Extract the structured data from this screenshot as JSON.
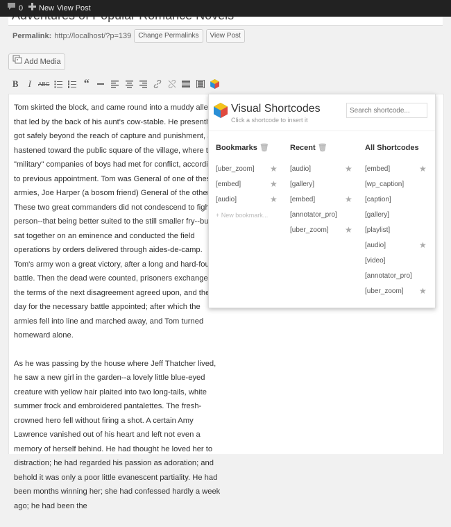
{
  "admin_bar": {
    "comments_count": "0",
    "new_label": "New",
    "view_post_label": "View Post"
  },
  "post": {
    "title_fragment": "Adventures of Popular Romance Novels"
  },
  "permalink": {
    "label": "Permalink:",
    "url": "http://localhost/?p=139",
    "change_button": "Change Permalinks",
    "view_button": "View Post"
  },
  "add_media_label": "Add Media",
  "editor": {
    "paragraphs": [
      "Tom skirted the block, and came round into a muddy alley that led by the back of his aunt's cow-stable. He presently got safely beyond the reach of capture and punishment, and hastened toward the public square of the village, where two \"military\" companies of boys had met for conflict, according to previous appointment. Tom was General of one of these armies, Joe Harper (a bosom friend) General of the other. These two great commanders did not condescend to fight in person--that being better suited to the still smaller fry--but sat together on an eminence and conducted the field operations by orders delivered through aides-de-camp. Tom's army won a great victory, after a long and hard-fought battle. Then the dead were counted, prisoners exchanged, the terms of the next disagreement agreed upon, and the day for the necessary battle appointed; after which the armies fell into line and marched away, and Tom turned homeward alone.",
      "As he was passing by the house where Jeff Thatcher lived, he saw a new girl in the garden--a lovely little blue-eyed creature with yellow hair plaited into two long-tails, white summer frock and embroidered pantalettes. The fresh-crowned hero fell without firing a shot. A certain Amy Lawrence vanished out of his heart and left not even a memory of herself behind. He had thought he loved her to distraction; he had regarded his passion as adoration; and behold it was only a poor little evanescent partiality. He had been months winning her; she had confessed hardly a week ago; he had been the"
    ]
  },
  "popup": {
    "title": "Visual Shortcodes",
    "subtitle": "Click a shortcode to insert it",
    "search_placeholder": "Search shortcode...",
    "bookmarks": {
      "title": "Bookmarks",
      "items": [
        "[uber_zoom]",
        "[embed]",
        "[audio]"
      ],
      "new_label": "+ New bookmark..."
    },
    "recent": {
      "title": "Recent",
      "items": [
        "[audio]",
        "[gallery]",
        "[embed]",
        "[annotator_pro]",
        "[uber_zoom]"
      ]
    },
    "all": {
      "title": "All Shortcodes",
      "items": [
        "[embed]",
        "[wp_caption]",
        "[caption]",
        "[gallery]",
        "[playlist]",
        "[audio]",
        "[video]",
        "[annotator_pro]",
        "[uber_zoom]"
      ]
    }
  },
  "colors": {
    "admin_bar": "#222222",
    "logo_blue": "#2a8fd6",
    "logo_yellow": "#f4c21b",
    "logo_red": "#e04a3f"
  }
}
